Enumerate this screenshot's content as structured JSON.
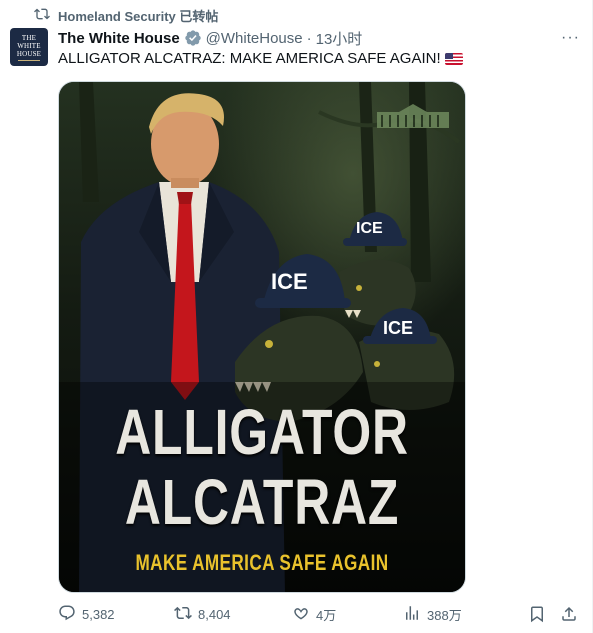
{
  "retweet": {
    "label": "Homeland Security 已转帖"
  },
  "author": {
    "avatar_text_line1": "THE",
    "avatar_text_line2": "WHITE",
    "avatar_text_line3": "HOUSE",
    "name": "The White House",
    "handle": "@WhiteHouse",
    "separator": "·",
    "time": "13小时",
    "verified_icon": "verified-badge-icon",
    "more_label": "···"
  },
  "tweet": {
    "text": "ALLIGATOR ALCATRAZ: MAKE AMERICA SAFE AGAIN!",
    "emoji": "us-flag-icon"
  },
  "media": {
    "title_line1": "ALLIGATOR",
    "title_line2": "ALCATRAZ",
    "subtitle": "MAKE AMERICA SAFE AGAIN",
    "cap_text_1": "ICE",
    "cap_text_2": "ICE",
    "cap_text_3": "ICE"
  },
  "actions": {
    "replies": "5,382",
    "reposts": "8,404",
    "likes": "4万",
    "views": "388万"
  },
  "colors": {
    "text_primary": "#0f1419",
    "text_secondary": "#536471",
    "verified": "#829aab",
    "poster_yellow": "#e9c22c"
  }
}
